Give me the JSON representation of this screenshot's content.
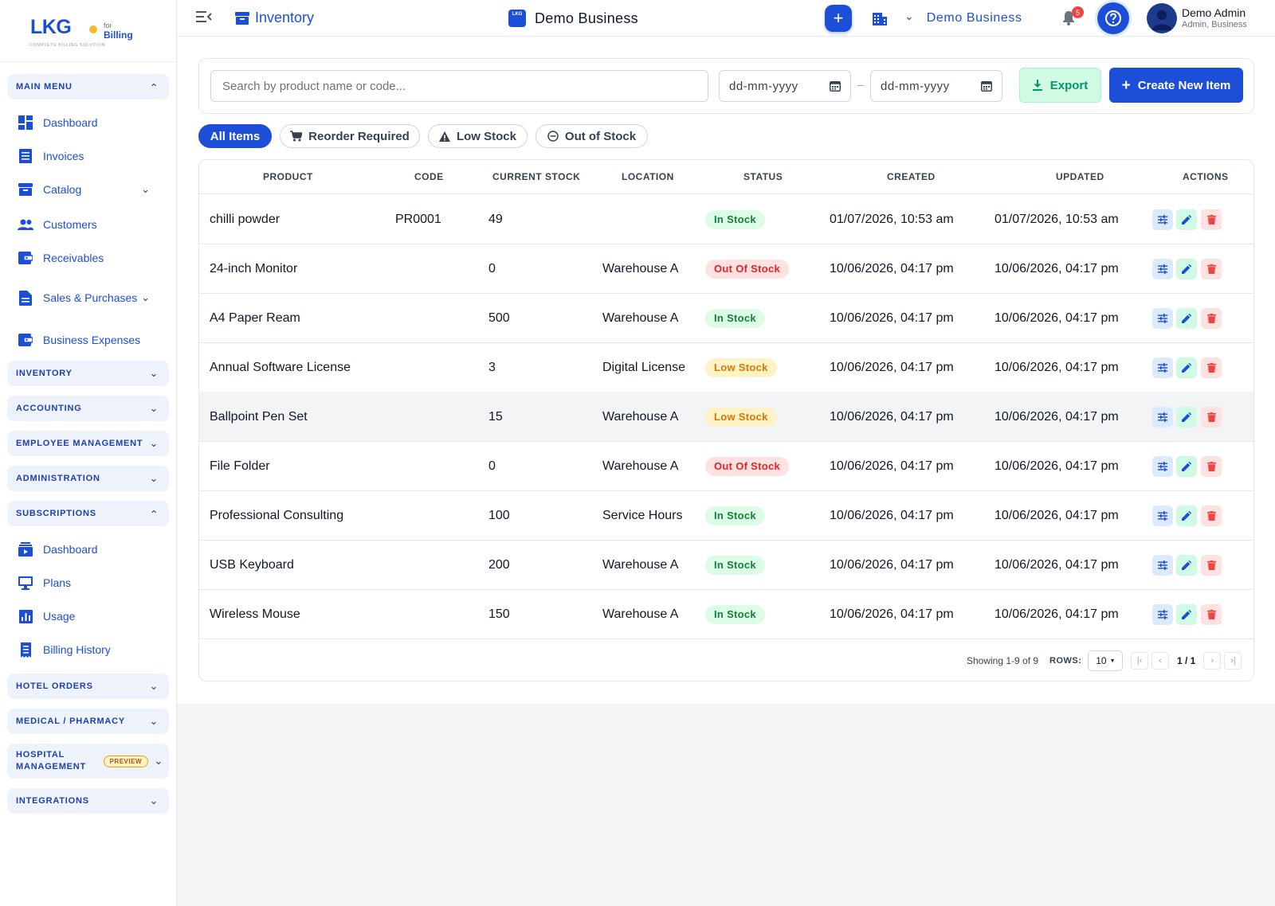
{
  "brand": {
    "logo_text": "LKG",
    "for_text": "for",
    "product_text": "Billing",
    "tagline": "COMPLETE BILLING SOLUTION"
  },
  "sidebar": {
    "main_menu": {
      "title": "MAIN MENU",
      "items": [
        {
          "label": "Dashboard",
          "icon": "dashboard-icon"
        },
        {
          "label": "Invoices",
          "icon": "invoice-icon"
        },
        {
          "label": "Catalog",
          "icon": "catalog-icon"
        },
        {
          "label": "Customers",
          "icon": "customers-icon"
        },
        {
          "label": "Receivables",
          "icon": "wallet-icon"
        },
        {
          "label": "Sales & Purchases",
          "icon": "document-icon"
        },
        {
          "label": "Business Expenses",
          "icon": "wallet-icon"
        }
      ]
    },
    "sections": {
      "inventory": "INVENTORY",
      "accounting": "ACCOUNTING",
      "employee_management": "EMPLOYEE MANAGEMENT",
      "administration": "ADMINISTRATION",
      "subscriptions": "SUBSCRIPTIONS",
      "hotel_orders": "HOTEL ORDERS",
      "medical_pharmacy": "MEDICAL / PHARMACY",
      "hospital_management": "HOSPITAL MANAGEMENT",
      "hospital_badge": "PREVIEW",
      "integrations": "INTEGRATIONS"
    },
    "subscriptions_items": [
      {
        "label": "Dashboard",
        "icon": "subscription-dashboard-icon"
      },
      {
        "label": "Plans",
        "icon": "plans-icon"
      },
      {
        "label": "Usage",
        "icon": "usage-chart-icon"
      },
      {
        "label": "Billing History",
        "icon": "receipt-icon"
      }
    ]
  },
  "topbar": {
    "page_title": "Inventory",
    "business_logo_text": "LKG",
    "business_name": "Demo Business",
    "business_switch": "Demo Business",
    "notification_count": "5",
    "user_name": "Demo Admin",
    "user_role": "Admin, Business"
  },
  "filters": {
    "search_placeholder": "Search by product name or code...",
    "date_from_placeholder": "dd-mm-yyyy",
    "date_separator": "–",
    "date_to_placeholder": "dd-mm-yyyy",
    "export_label": "Export",
    "create_label": "Create New Item",
    "chips": [
      "All Items",
      "Reorder Required",
      "Low Stock",
      "Out of Stock"
    ],
    "active_chip": "All Items"
  },
  "table": {
    "headers": [
      "PRODUCT",
      "CODE",
      "CURRENT STOCK",
      "LOCATION",
      "STATUS",
      "CREATED",
      "UPDATED",
      "ACTIONS"
    ],
    "rows": [
      {
        "product": "chilli powder",
        "code": "PR0001",
        "stock": "49",
        "location": "",
        "status": "In Stock",
        "status_type": "in",
        "created": "01/07/2026, 10:53 am",
        "updated": "01/07/2026, 10:53 am"
      },
      {
        "product": "24-inch Monitor",
        "code": "",
        "stock": "0",
        "location": "Warehouse A",
        "status": "Out Of Stock",
        "status_type": "out",
        "created": "10/06/2026, 04:17 pm",
        "updated": "10/06/2026, 04:17 pm"
      },
      {
        "product": "A4 Paper Ream",
        "code": "",
        "stock": "500",
        "location": "Warehouse A",
        "status": "In Stock",
        "status_type": "in",
        "created": "10/06/2026, 04:17 pm",
        "updated": "10/06/2026, 04:17 pm"
      },
      {
        "product": "Annual Software License",
        "code": "",
        "stock": "3",
        "location": "Digital License",
        "status": "Low Stock",
        "status_type": "low",
        "created": "10/06/2026, 04:17 pm",
        "updated": "10/06/2026, 04:17 pm"
      },
      {
        "product": "Ballpoint Pen Set",
        "code": "",
        "stock": "15",
        "location": "Warehouse A",
        "status": "Low Stock",
        "status_type": "low",
        "created": "10/06/2026, 04:17 pm",
        "updated": "10/06/2026, 04:17 pm"
      },
      {
        "product": "File Folder",
        "code": "",
        "stock": "0",
        "location": "Warehouse A",
        "status": "Out Of Stock",
        "status_type": "out",
        "created": "10/06/2026, 04:17 pm",
        "updated": "10/06/2026, 04:17 pm"
      },
      {
        "product": "Professional Consulting",
        "code": "",
        "stock": "100",
        "location": "Service Hours",
        "status": "In Stock",
        "status_type": "in",
        "created": "10/06/2026, 04:17 pm",
        "updated": "10/06/2026, 04:17 pm"
      },
      {
        "product": "USB Keyboard",
        "code": "",
        "stock": "200",
        "location": "Warehouse A",
        "status": "In Stock",
        "status_type": "in",
        "created": "10/06/2026, 04:17 pm",
        "updated": "10/06/2026, 04:17 pm"
      },
      {
        "product": "Wireless Mouse",
        "code": "",
        "stock": "150",
        "location": "Warehouse A",
        "status": "In Stock",
        "status_type": "in",
        "created": "10/06/2026, 04:17 pm",
        "updated": "10/06/2026, 04:17 pm"
      }
    ]
  },
  "pagination": {
    "showing_text": "Showing 1-9 of 9",
    "rows_label": "ROWS:",
    "rows_per_page": "10",
    "page_text": "1 / 1"
  },
  "colors": {
    "accent": "#1d4ed8",
    "in_stock": "#15803d",
    "out_of_stock": "#dc2626",
    "low_stock": "#d97706",
    "export_green": "#059669"
  }
}
